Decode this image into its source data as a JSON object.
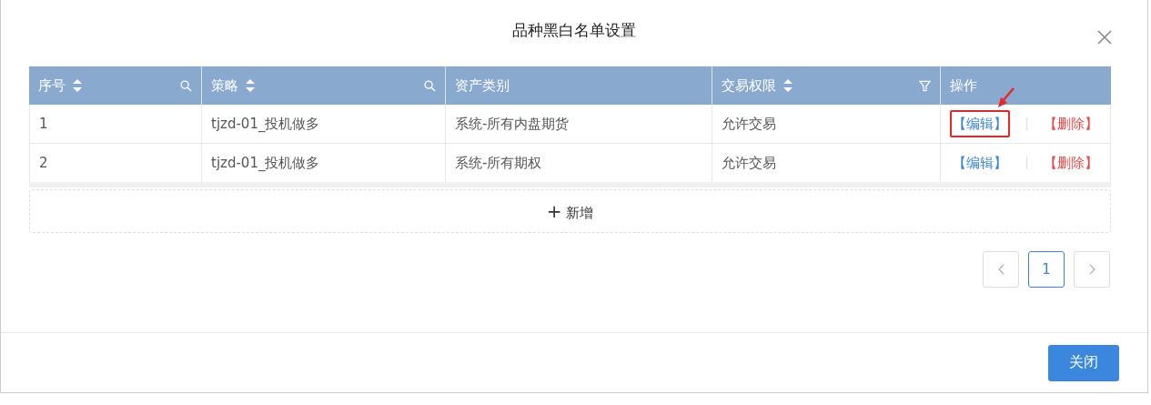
{
  "dialog": {
    "title": "品种黑白名单设置"
  },
  "table": {
    "columns": [
      {
        "label": "序号",
        "sort": true,
        "search": true,
        "filter": false
      },
      {
        "label": "策略",
        "sort": true,
        "search": true,
        "filter": false
      },
      {
        "label": "资产类别",
        "sort": false,
        "search": false,
        "filter": false
      },
      {
        "label": "交易权限",
        "sort": true,
        "search": false,
        "filter": true
      },
      {
        "label": "操作",
        "sort": false,
        "search": false,
        "filter": false
      }
    ],
    "rows": [
      {
        "cells": [
          "1",
          "tjzd-01_投机做多",
          "系统-所有内盘期货",
          "允许交易"
        ],
        "edit": "【编辑】",
        "delete": "【删除】",
        "highlighted": true
      },
      {
        "cells": [
          "2",
          "tjzd-01_投机做多",
          "系统-所有期权",
          "允许交易"
        ],
        "edit": "【编辑】",
        "delete": "【删除】",
        "highlighted": false
      }
    ]
  },
  "add_button": {
    "icon": "+",
    "label": "新增"
  },
  "pagination": {
    "pages": [
      {
        "label": "1",
        "selected": true
      }
    ]
  },
  "footer": {
    "close_button": "关闭"
  }
}
